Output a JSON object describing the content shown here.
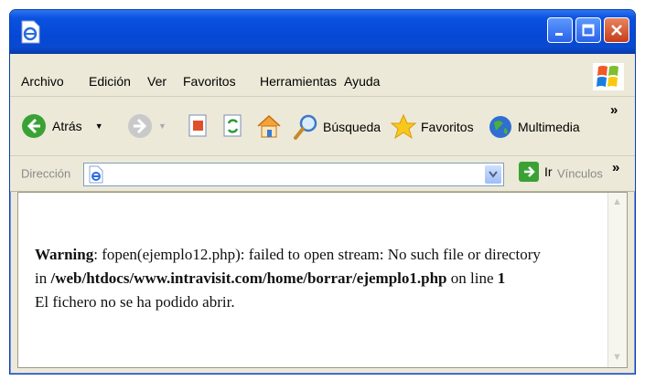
{
  "window": {
    "title": ""
  },
  "menubar": {
    "items": [
      "Archivo",
      "Edición",
      "Ver",
      "Favoritos",
      "Herramientas",
      "Ayuda"
    ]
  },
  "toolbar": {
    "back_label": "Atrás",
    "search_label": "Búsqueda",
    "favorites_label": "Favoritos",
    "media_label": "Multimedia",
    "overflow": "»"
  },
  "addressbar": {
    "label": "Dirección",
    "value": "",
    "go_label": "Ir",
    "links_label": "Vínculos",
    "overflow": "»"
  },
  "content": {
    "warning_word": "Warning",
    "line1_rest": ": fopen(ejemplo12.php): failed to open stream: No such file or directory",
    "line2_prefix": "in ",
    "line2_path": "/web/htdocs/www.intravisit.com/home/borrar/ejemplo1.php",
    "line2_mid": " on line ",
    "line2_num": "1",
    "line3": "El fichero no se ha podido abrir."
  },
  "colors": {
    "titlebar": "#0648d6",
    "chrome": "#ece9d8",
    "close_button": "#c63d1a"
  }
}
